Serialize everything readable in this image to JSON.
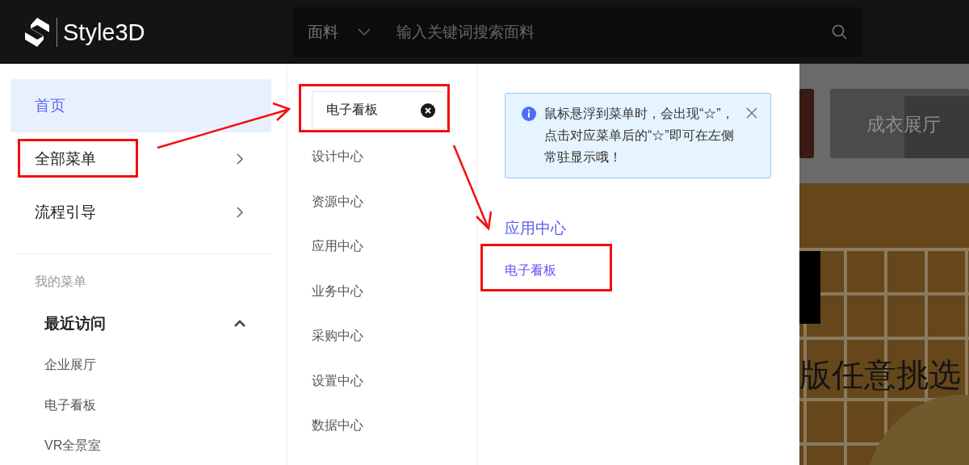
{
  "header": {
    "logo_text": "Style3D",
    "search": {
      "category": "面料",
      "placeholder": "输入关键词搜索面料"
    }
  },
  "sidebar": {
    "items": [
      {
        "label": "首页",
        "kind": "link",
        "selected": true
      },
      {
        "label": "全部菜单",
        "kind": "submenu",
        "selected": false
      },
      {
        "label": "流程引导",
        "kind": "submenu",
        "selected": false
      }
    ],
    "section_title": "我的菜单",
    "groups": [
      {
        "title": "最近访问",
        "expanded": true,
        "items": [
          "企业展厅",
          "电子看板",
          "VR全景室"
        ]
      }
    ]
  },
  "menu": {
    "search": {
      "value": "电子看板"
    },
    "items": [
      "设计中心",
      "资源中心",
      "应用中心",
      "业务中心",
      "采购中心",
      "设置中心",
      "数据中心"
    ]
  },
  "results": {
    "notice": "鼠标悬浮到菜单时，会出现“☆”，点击对应菜单后的“☆”即可在左侧常驻显示哦！",
    "section": "应用中心",
    "items": [
      "电子看板"
    ]
  },
  "background": {
    "card_label": "成衣展厅",
    "banner_text": "版任意挑选"
  }
}
